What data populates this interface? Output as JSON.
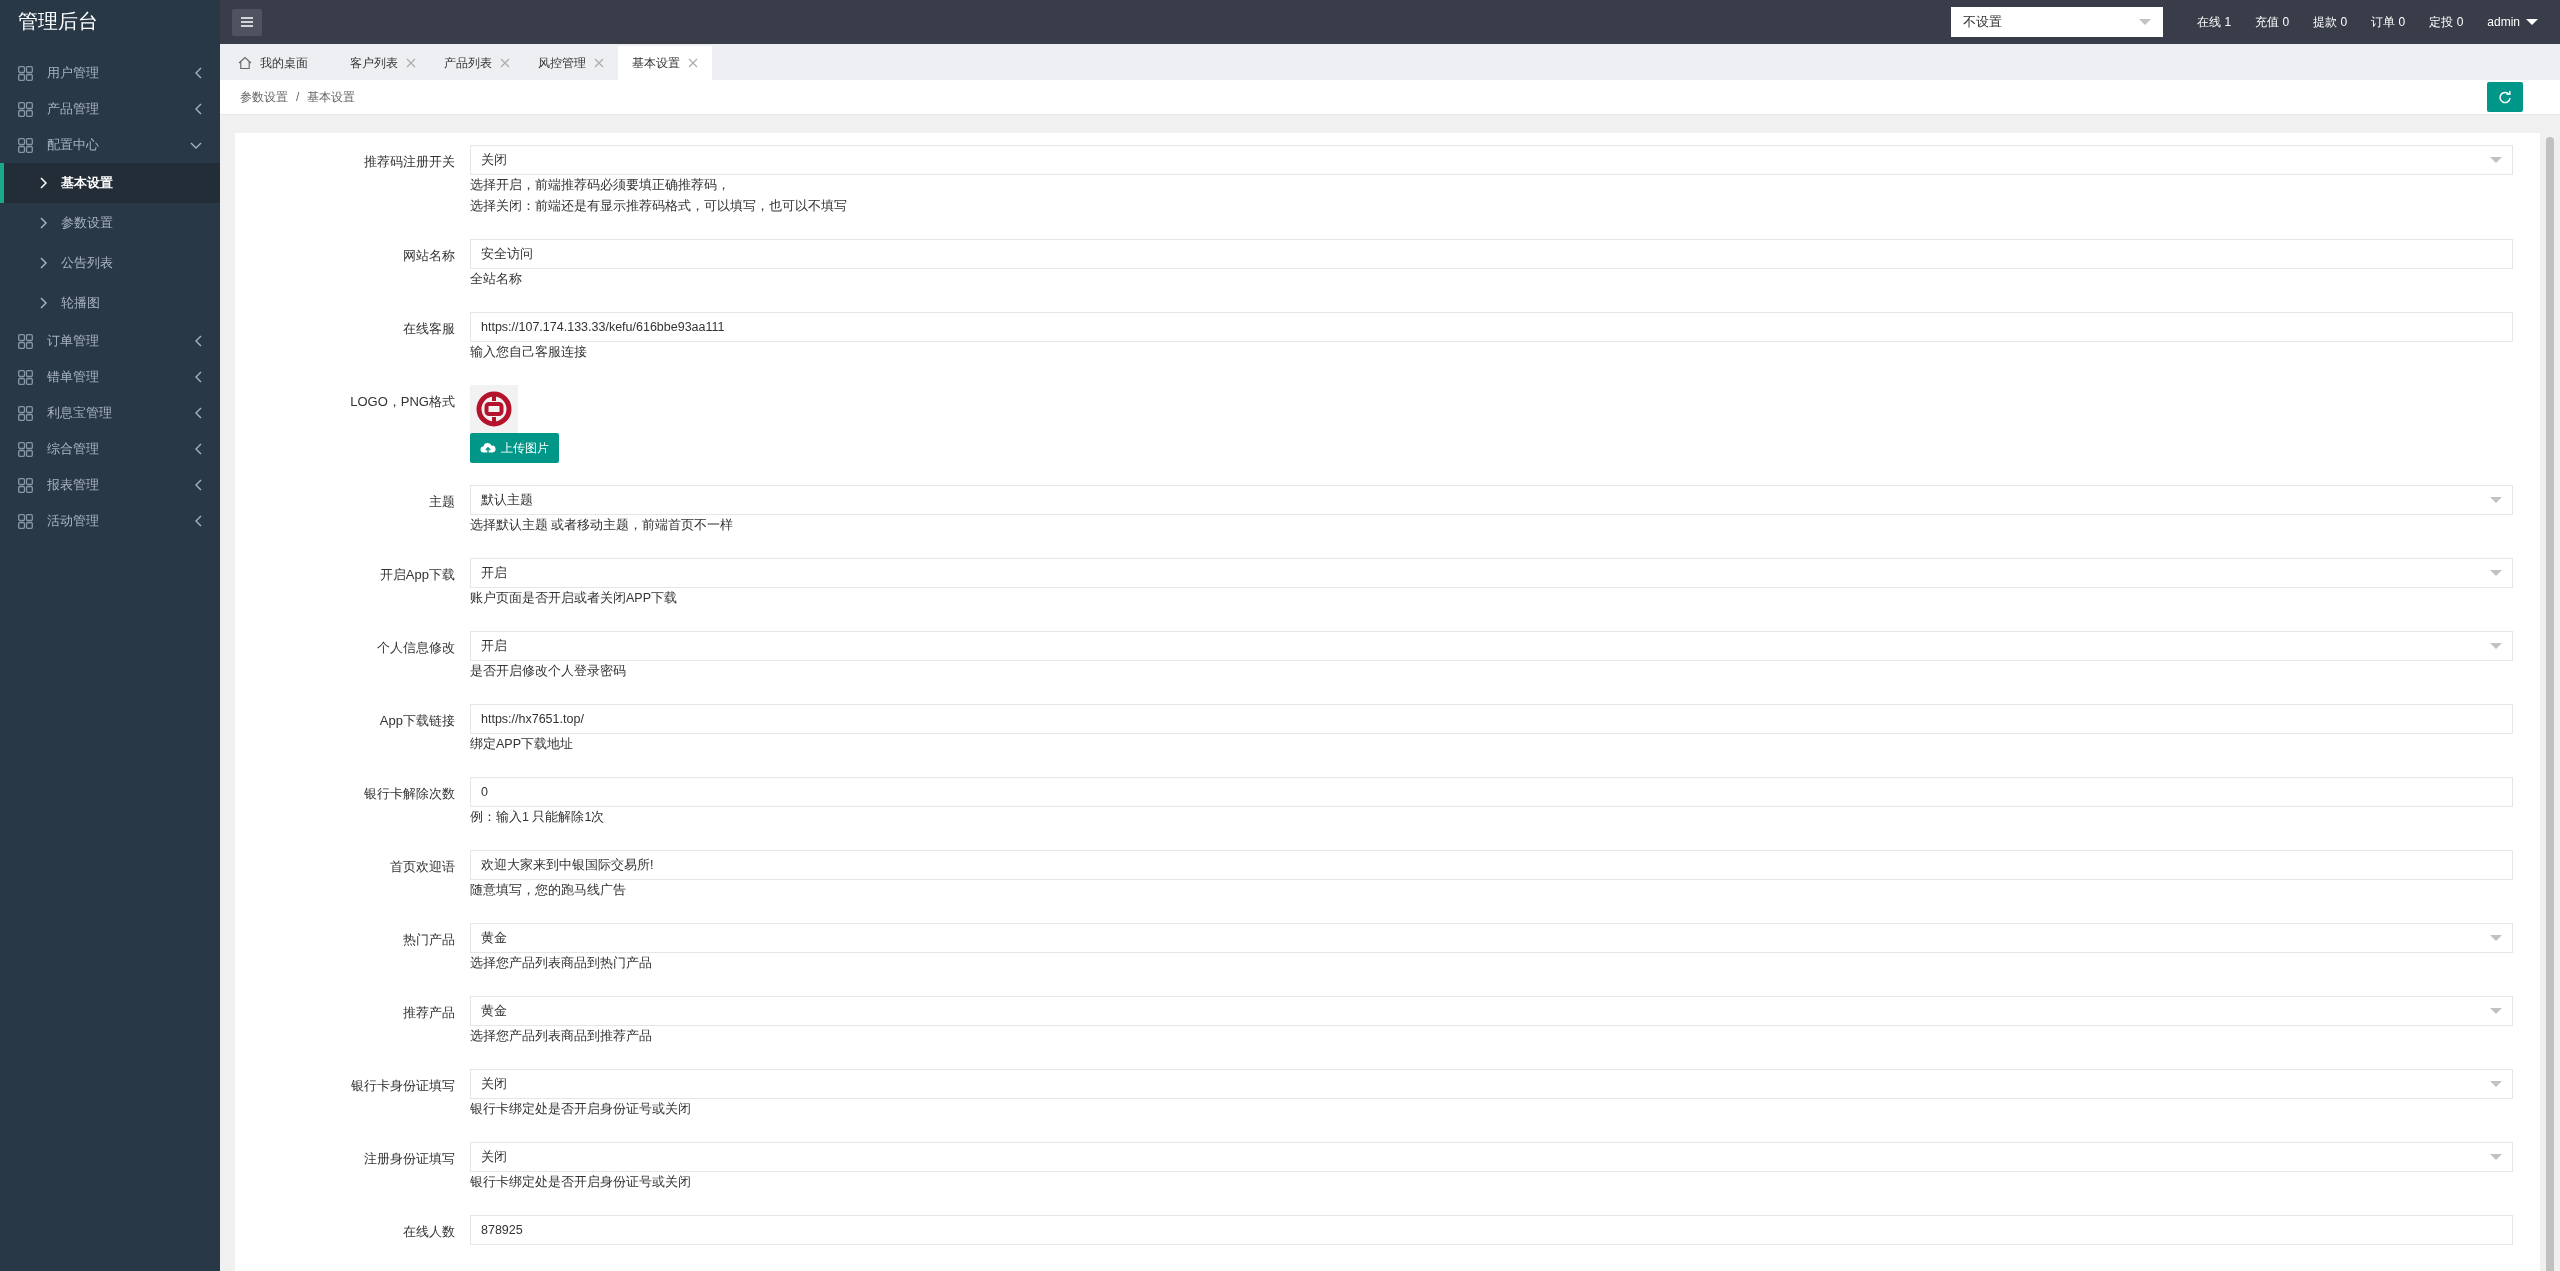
{
  "header": {
    "title": "管理后台",
    "filter_select": {
      "value": "不设置"
    },
    "stats": [
      "在线 1",
      "充值 0",
      "提款 0",
      "订单 0",
      "定投 0"
    ],
    "user": "admin"
  },
  "sidebar": {
    "items": [
      {
        "label": "用户管理",
        "expanded": false
      },
      {
        "label": "产品管理",
        "expanded": false
      },
      {
        "label": "配置中心",
        "expanded": true,
        "children": [
          {
            "label": "基本设置",
            "selected": true
          },
          {
            "label": "参数设置",
            "selected": false
          },
          {
            "label": "公告列表",
            "selected": false
          },
          {
            "label": "轮播图",
            "selected": false
          }
        ]
      },
      {
        "label": "订单管理",
        "expanded": false
      },
      {
        "label": "错单管理",
        "expanded": false
      },
      {
        "label": "利息宝管理",
        "expanded": false
      },
      {
        "label": "综合管理",
        "expanded": false
      },
      {
        "label": "报表管理",
        "expanded": false
      },
      {
        "label": "活动管理",
        "expanded": false
      }
    ]
  },
  "tabs": [
    {
      "label": "我的桌面",
      "kind": "home",
      "selected": false
    },
    {
      "label": "客户列表",
      "kind": "page",
      "selected": false
    },
    {
      "label": "产品列表",
      "kind": "page",
      "selected": false
    },
    {
      "label": "风控管理",
      "kind": "page",
      "selected": false
    },
    {
      "label": "基本设置",
      "kind": "page",
      "selected": true
    }
  ],
  "breadcrumb": [
    "参数设置",
    "基本设置"
  ],
  "breadcrumb_separator": "/",
  "fields": [
    {
      "label": "推荐码注册开关",
      "kind": "select",
      "value": "关闭",
      "hints": [
        "选择开启，前端推荐码必须要填正确推荐码，",
        "选择关闭：前端还是有显示推荐码格式，可以填写，也可以不填写"
      ]
    },
    {
      "label": "网站名称",
      "kind": "text",
      "value": "安全访问",
      "hints": [
        "全站名称"
      ]
    },
    {
      "label": "在线客服",
      "kind": "text",
      "value": "https://107.174.133.33/kefu/616bbe93aa111",
      "hints": [
        "输入您自己客服连接"
      ]
    },
    {
      "label": "LOGO，PNG格式",
      "kind": "image",
      "button": "上传图片"
    },
    {
      "label": "主题",
      "kind": "select",
      "value": "默认主题",
      "hints": [
        "选择默认主题 或者移动主题，前端首页不一样"
      ]
    },
    {
      "label": "开启App下载",
      "kind": "select",
      "value": "开启",
      "hints": [
        "账户页面是否开启或者关闭APP下载"
      ]
    },
    {
      "label": "个人信息修改",
      "kind": "select",
      "value": "开启",
      "hints": [
        "是否开启修改个人登录密码"
      ]
    },
    {
      "label": "App下载链接",
      "kind": "text",
      "value": "https://hx7651.top/",
      "hints": [
        "绑定APP下载地址"
      ]
    },
    {
      "label": "银行卡解除次数",
      "kind": "text",
      "value": "0",
      "hints": [
        "例：输入1 只能解除1次"
      ]
    },
    {
      "label": "首页欢迎语",
      "kind": "text",
      "value": "欢迎大家来到中银国际交易所!",
      "hints": [
        "随意填写，您的跑马线广告"
      ]
    },
    {
      "label": "热门产品",
      "kind": "select",
      "value": "黄金",
      "hints": [
        "选择您产品列表商品到热门产品"
      ]
    },
    {
      "label": "推荐产品",
      "kind": "select",
      "value": "黄金",
      "hints": [
        "选择您产品列表商品到推荐产品"
      ]
    },
    {
      "label": "银行卡身份证填写",
      "kind": "select",
      "value": "关闭",
      "hints": [
        "银行卡绑定处是否开启身份证号或关闭"
      ]
    },
    {
      "label": "注册身份证填写",
      "kind": "select",
      "value": "关闭",
      "hints": [
        "银行卡绑定处是否开启身份证号或关闭"
      ]
    },
    {
      "label": "在线人数",
      "kind": "text",
      "value": "878925"
    }
  ]
}
